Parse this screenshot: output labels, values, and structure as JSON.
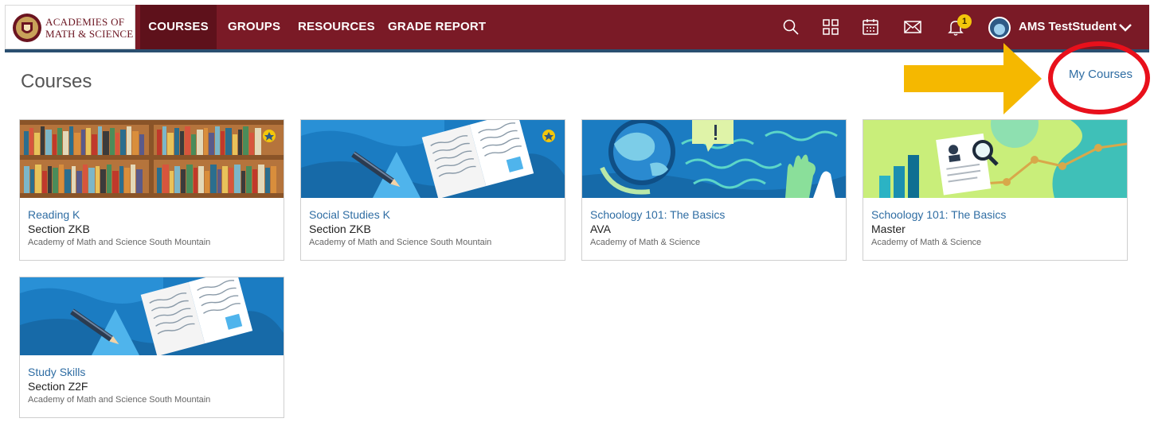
{
  "brand": {
    "line1": "Academies of",
    "line2": "Math & Science"
  },
  "nav": {
    "items": [
      {
        "label": "COURSES",
        "active": true
      },
      {
        "label": "GROUPS",
        "active": false
      },
      {
        "label": "RESOURCES",
        "active": false
      },
      {
        "label": "GRADE REPORT",
        "active": false
      }
    ]
  },
  "header_icons": [
    "search-icon",
    "apps-grid-icon",
    "calendar-icon",
    "mail-icon",
    "bell-icon"
  ],
  "notifications": {
    "count": "1"
  },
  "user": {
    "name": "AMS TestStudent"
  },
  "page": {
    "title": "Courses",
    "my_courses_link": "My Courses"
  },
  "annotation": {
    "arrow_color": "#f5b800",
    "circle_color": "#e8101b"
  },
  "colors": {
    "nav_bg": "#7a1a26",
    "nav_active": "#5e111b",
    "link": "#2f6da3",
    "badge": "#f3c60b"
  },
  "courses": [
    {
      "title": "Reading K",
      "section": "Section ZKB",
      "school": "Academy of Math and Science South Mountain",
      "art": "bookshelf",
      "starred": true
    },
    {
      "title": "Social Studies K",
      "section": "Section ZKB",
      "school": "Academy of Math and Science South Mountain",
      "art": "open-book",
      "starred": true
    },
    {
      "title": "Schoology 101: The Basics",
      "section": "AVA",
      "school": "Academy of Math & Science",
      "art": "globe",
      "starred": false
    },
    {
      "title": "Schoology 101: The Basics",
      "section": "Master",
      "school": "Academy of Math & Science",
      "art": "chart",
      "starred": false
    },
    {
      "title": "Study Skills",
      "section": "Section Z2F",
      "school": "Academy of Math and Science South Mountain",
      "art": "open-book",
      "starred": false
    }
  ]
}
